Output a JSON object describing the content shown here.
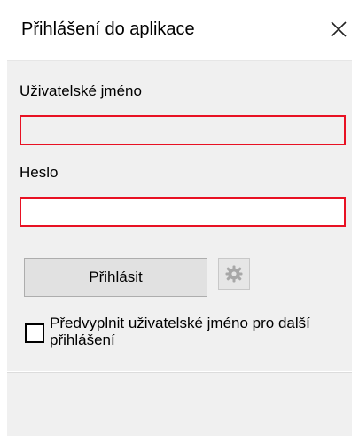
{
  "window": {
    "title": "Přihlášení do aplikace",
    "close_icon": "close-icon"
  },
  "form": {
    "username_label": "Uživatelské jméno",
    "username_value": "",
    "password_label": "Heslo",
    "password_value": "",
    "login_button": "Přihlásit",
    "settings_icon": "gear-icon",
    "remember_checked": false,
    "remember_label": "Předvyplnit uživatelské jméno pro další přihlášení"
  },
  "colors": {
    "error_border": "#e81123",
    "panel_bg": "#f0f0f0"
  }
}
